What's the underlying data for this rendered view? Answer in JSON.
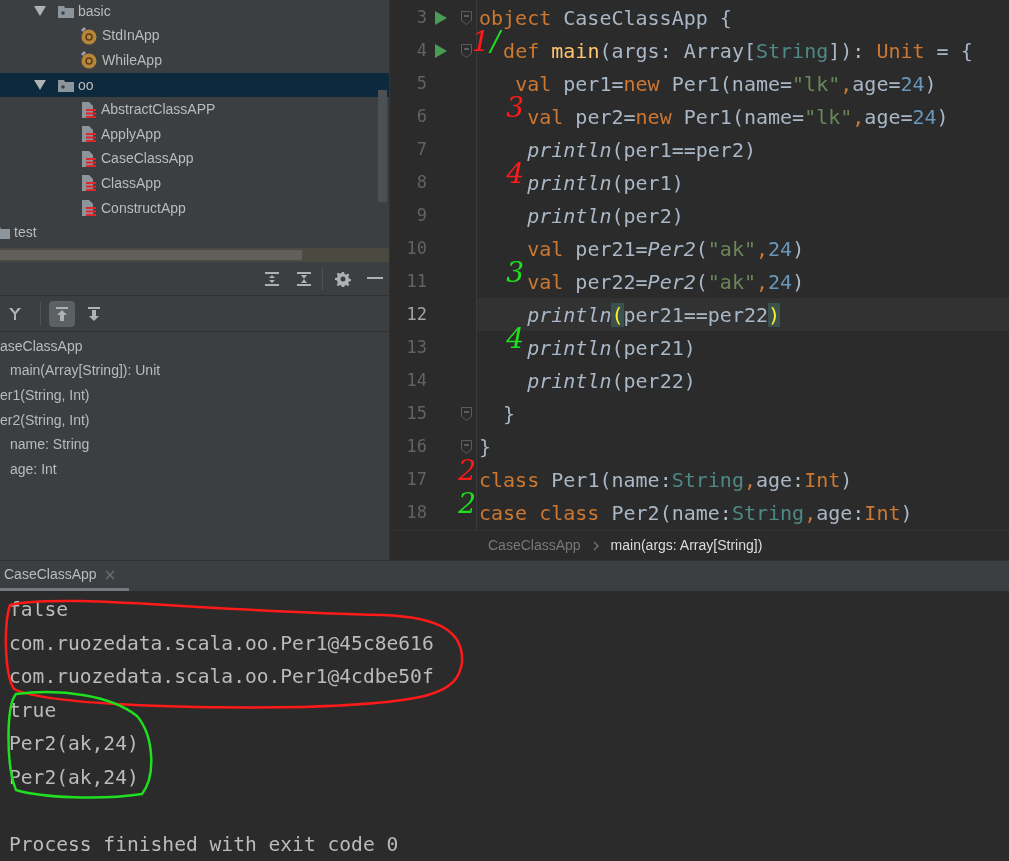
{
  "project_tree": [
    {
      "label": "basic",
      "kind": "package",
      "expanded": true,
      "selected": false,
      "children": [
        {
          "label": "StdInApp",
          "kind": "object",
          "selected": false
        },
        {
          "label": "WhileApp",
          "kind": "object",
          "selected": false
        }
      ]
    },
    {
      "label": "oo",
      "kind": "package",
      "expanded": true,
      "selected": true,
      "children": [
        {
          "label": "AbstractClassAPP",
          "kind": "class",
          "selected": false
        },
        {
          "label": "ApplyApp",
          "kind": "class",
          "selected": false
        },
        {
          "label": "CaseClassApp",
          "kind": "class",
          "selected": false
        },
        {
          "label": "ClassApp",
          "kind": "class",
          "selected": false
        },
        {
          "label": "ConstructApp",
          "kind": "class",
          "selected": false
        }
      ]
    }
  ],
  "project_outer_items": [
    {
      "label": "test",
      "kind": "folder",
      "selected": false
    }
  ],
  "structure_toolbar": [
    {
      "kind": "filter",
      "selected": false
    },
    {
      "kind": "scroll-from-source",
      "selected": true
    },
    {
      "kind": "scroll-to-source",
      "selected": false
    }
  ],
  "structure_tree": [
    {
      "label": "aseClassApp",
      "children": [
        {
          "label": "main(Array[String]): Unit"
        }
      ]
    },
    {
      "label": "er1(String, Int)"
    },
    {
      "label": "er2(String, Int)",
      "children": [
        {
          "label": "name: String"
        },
        {
          "label": "age: Int"
        }
      ]
    }
  ],
  "code": {
    "lines": [
      {
        "number": "3",
        "runnable": true,
        "foldable": true,
        "current": false,
        "tokens": [
          {
            "text": "object",
            "kind": "keyword"
          },
          {
            "text": " CaseClassApp {",
            "kind": "plain"
          }
        ]
      },
      {
        "number": "4",
        "runnable": true,
        "foldable": true,
        "current": false,
        "marks": [
          {
            "text": "1",
            "color": "#ff1a1a"
          },
          {
            "text": "/",
            "color": "#1fe01f"
          }
        ],
        "tokens": [
          {
            "text": "  def ",
            "kind": "keyword"
          },
          {
            "text": "main",
            "kind": "function"
          },
          {
            "text": "(args: Array[",
            "kind": "plain"
          },
          {
            "text": "String",
            "kind": "type"
          },
          {
            "text": "]): ",
            "kind": "plain"
          },
          {
            "text": "Unit",
            "kind": "keyword"
          },
          {
            "text": " = {",
            "kind": "plain"
          }
        ]
      },
      {
        "number": "5",
        "runnable": false,
        "foldable": false,
        "current": false,
        "tokens": [
          {
            "text": "   val",
            "kind": "keyword"
          },
          {
            "text": " per1=",
            "kind": "plain"
          },
          {
            "text": "new",
            "kind": "keyword"
          },
          {
            "text": " Per1(name=",
            "kind": "plain"
          },
          {
            "text": "\"lk\"",
            "kind": "string"
          },
          {
            "text": ",",
            "kind": "keyword"
          },
          {
            "text": "age=",
            "kind": "plain"
          },
          {
            "text": "24",
            "kind": "number"
          },
          {
            "text": ")",
            "kind": "plain"
          }
        ]
      },
      {
        "number": "6",
        "runnable": false,
        "foldable": false,
        "current": false,
        "marks": [
          {
            "text": "3",
            "color": "#ff1a1a"
          }
        ],
        "tokens": [
          {
            "text": "    val",
            "kind": "keyword"
          },
          {
            "text": " per2=",
            "kind": "plain"
          },
          {
            "text": "new",
            "kind": "keyword"
          },
          {
            "text": " Per1(name=",
            "kind": "plain"
          },
          {
            "text": "\"lk\"",
            "kind": "string"
          },
          {
            "text": ",",
            "kind": "keyword"
          },
          {
            "text": "age=",
            "kind": "plain"
          },
          {
            "text": "24",
            "kind": "number"
          },
          {
            "text": ")",
            "kind": "plain"
          }
        ]
      },
      {
        "number": "7",
        "runnable": false,
        "foldable": false,
        "current": false,
        "tokens": [
          {
            "text": "    println",
            "kind": "italic"
          },
          {
            "text": "(per1==per2)",
            "kind": "plain"
          }
        ]
      },
      {
        "number": "8",
        "runnable": false,
        "foldable": false,
        "current": false,
        "marks": [
          {
            "text": "4",
            "color": "#ff1a1a"
          }
        ],
        "tokens": [
          {
            "text": "    println",
            "kind": "italic"
          },
          {
            "text": "(per1)",
            "kind": "plain"
          }
        ]
      },
      {
        "number": "9",
        "runnable": false,
        "foldable": false,
        "current": false,
        "tokens": [
          {
            "text": "    println",
            "kind": "italic"
          },
          {
            "text": "(per2)",
            "kind": "plain"
          }
        ]
      },
      {
        "number": "10",
        "runnable": false,
        "foldable": false,
        "current": false,
        "tokens": [
          {
            "text": "    val",
            "kind": "keyword"
          },
          {
            "text": " per21=",
            "kind": "plain"
          },
          {
            "text": "Per2",
            "kind": "italic"
          },
          {
            "text": "(",
            "kind": "plain"
          },
          {
            "text": "\"ak\"",
            "kind": "string"
          },
          {
            "text": ",",
            "kind": "keyword"
          },
          {
            "text": "24",
            "kind": "number"
          },
          {
            "text": ")",
            "kind": "plain"
          }
        ]
      },
      {
        "number": "11",
        "runnable": false,
        "foldable": false,
        "current": false,
        "marks": [
          {
            "text": "3",
            "color": "#1fe01f"
          }
        ],
        "tokens": [
          {
            "text": "    val",
            "kind": "keyword"
          },
          {
            "text": " per22=",
            "kind": "plain"
          },
          {
            "text": "Per2",
            "kind": "italic"
          },
          {
            "text": "(",
            "kind": "plain"
          },
          {
            "text": "\"ak\"",
            "kind": "string"
          },
          {
            "text": ",",
            "kind": "keyword"
          },
          {
            "text": "24",
            "kind": "number"
          },
          {
            "text": ")",
            "kind": "plain"
          }
        ]
      },
      {
        "number": "12",
        "runnable": false,
        "foldable": false,
        "current": true,
        "tokens": [
          {
            "text": "    println",
            "kind": "italic"
          },
          {
            "text": "(",
            "kind": "paren-match"
          },
          {
            "text": "per21==per22",
            "kind": "plain"
          },
          {
            "text": ")",
            "kind": "paren-match"
          }
        ]
      },
      {
        "number": "13",
        "runnable": false,
        "foldable": false,
        "current": false,
        "marks": [
          {
            "text": "4",
            "color": "#1fe01f"
          }
        ],
        "tokens": [
          {
            "text": "    println",
            "kind": "italic"
          },
          {
            "text": "(per21)",
            "kind": "plain"
          }
        ]
      },
      {
        "number": "14",
        "runnable": false,
        "foldable": false,
        "current": false,
        "tokens": [
          {
            "text": "    println",
            "kind": "italic"
          },
          {
            "text": "(per22)",
            "kind": "plain"
          }
        ]
      },
      {
        "number": "15",
        "runnable": false,
        "foldable": true,
        "current": false,
        "tokens": [
          {
            "text": "  }",
            "kind": "plain"
          }
        ]
      },
      {
        "number": "16",
        "runnable": false,
        "foldable": true,
        "current": false,
        "tokens": [
          {
            "text": "}",
            "kind": "plain"
          }
        ]
      },
      {
        "number": "17",
        "runnable": false,
        "foldable": false,
        "current": false,
        "marks": [
          {
            "text": "2",
            "color": "#ff1a1a"
          }
        ],
        "tokens": [
          {
            "text": "class",
            "kind": "keyword"
          },
          {
            "text": " Per1(name:",
            "kind": "plain"
          },
          {
            "text": "String",
            "kind": "type"
          },
          {
            "text": ",",
            "kind": "keyword"
          },
          {
            "text": "age:",
            "kind": "plain"
          },
          {
            "text": "Int",
            "kind": "keyword"
          },
          {
            "text": ")",
            "kind": "plain"
          }
        ]
      },
      {
        "number": "18",
        "runnable": false,
        "foldable": false,
        "current": false,
        "marks": [
          {
            "text": "2",
            "color": "#1fe01f"
          }
        ],
        "tokens": [
          {
            "text": "case class",
            "kind": "keyword"
          },
          {
            "text": " Per2(name:",
            "kind": "plain"
          },
          {
            "text": "String",
            "kind": "type"
          },
          {
            "text": ",",
            "kind": "keyword"
          },
          {
            "text": "age:",
            "kind": "plain"
          },
          {
            "text": "Int",
            "kind": "keyword"
          },
          {
            "text": ")",
            "kind": "plain"
          }
        ]
      }
    ]
  },
  "breadcrumbs": [
    {
      "label": "CaseClassApp",
      "selected": false
    },
    {
      "label": "main(args: Array[String])",
      "selected": true
    }
  ],
  "run_tabs": [
    {
      "label": "CaseClassApp",
      "selected": true
    }
  ],
  "console": {
    "groups": [
      {
        "color": "#ff1a1a",
        "lines": [
          "false",
          "com.ruozedata.scala.oo.Per1@45c8e616",
          "com.ruozedata.scala.oo.Per1@4cdbe50f"
        ]
      },
      {
        "color": "#1fe01f",
        "lines": [
          "true",
          "Per2(ak,24)",
          "Per2(ak,24)"
        ]
      }
    ],
    "exit_message": "Process finished with exit code 0"
  }
}
